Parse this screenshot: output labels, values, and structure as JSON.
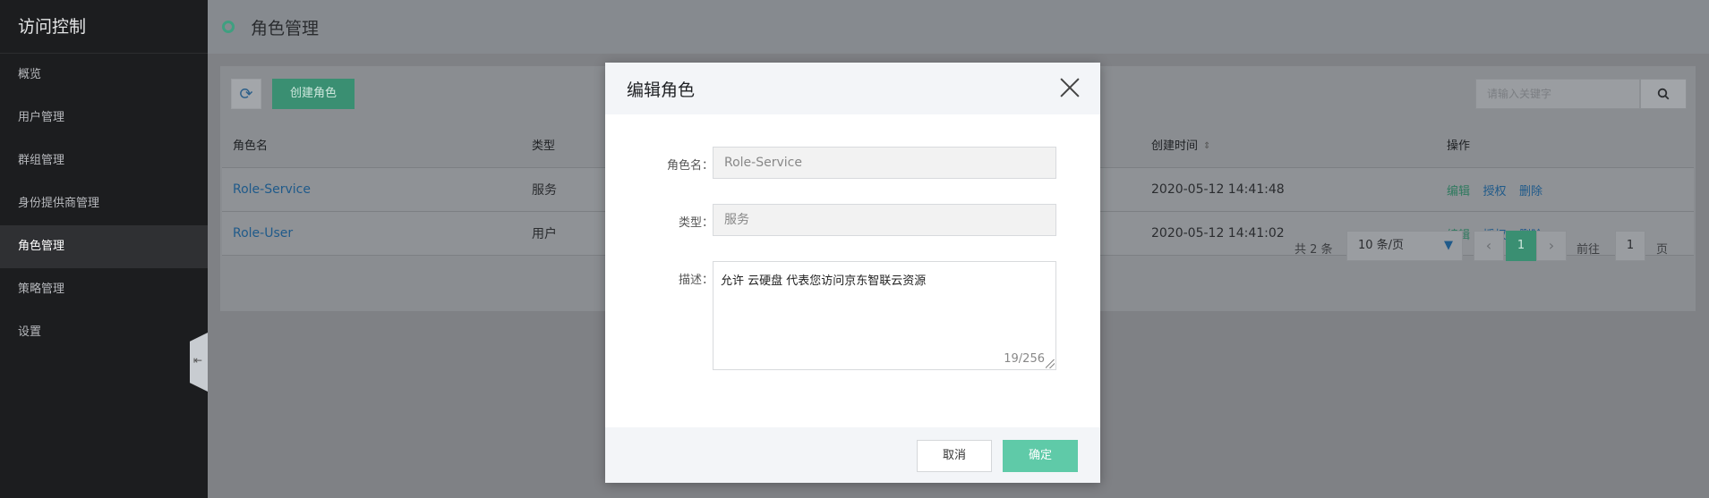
{
  "sidebar": {
    "title": "访问控制",
    "items": [
      {
        "label": "概览"
      },
      {
        "label": "用户管理"
      },
      {
        "label": "群组管理"
      },
      {
        "label": "身份提供商管理"
      },
      {
        "label": "角色管理"
      },
      {
        "label": "策略管理"
      },
      {
        "label": "设置"
      }
    ],
    "active_index": 4
  },
  "header": {
    "title": "角色管理"
  },
  "toolbar": {
    "create_label": "创建角色",
    "search_placeholder": "请输入关键字"
  },
  "table": {
    "headers": {
      "name": "角色名",
      "type": "类型",
      "created": "创建时间",
      "ops": "操作"
    },
    "rows": [
      {
        "name": "Role-Service",
        "type": "服务",
        "created": "2020-05-12 14:41:48"
      },
      {
        "name": "Role-User",
        "type": "用户",
        "created": "2020-05-12 14:41:02"
      }
    ],
    "ops": {
      "edit": "编辑",
      "grant": "授权",
      "delete": "删除"
    }
  },
  "pagination": {
    "total": "共 2 条",
    "page_size": "10 条/页",
    "current_page": "1",
    "goto_label": "前往",
    "goto_value": "1",
    "page_unit": "页"
  },
  "modal": {
    "title": "编辑角色",
    "fields": {
      "name_label": "角色名：",
      "name_value": "Role-Service",
      "type_label": "类型：",
      "type_value": "服务",
      "desc_label": "描述：",
      "desc_value": "允许 云硬盘 代表您访问京东智联云资源",
      "desc_counter": "19/256"
    },
    "cancel_label": "取消",
    "ok_label": "确定"
  },
  "colors": {
    "accent": "#5fcaa8",
    "sidebar_bg": "#1c1d1f",
    "link": "#2a8ad9"
  }
}
